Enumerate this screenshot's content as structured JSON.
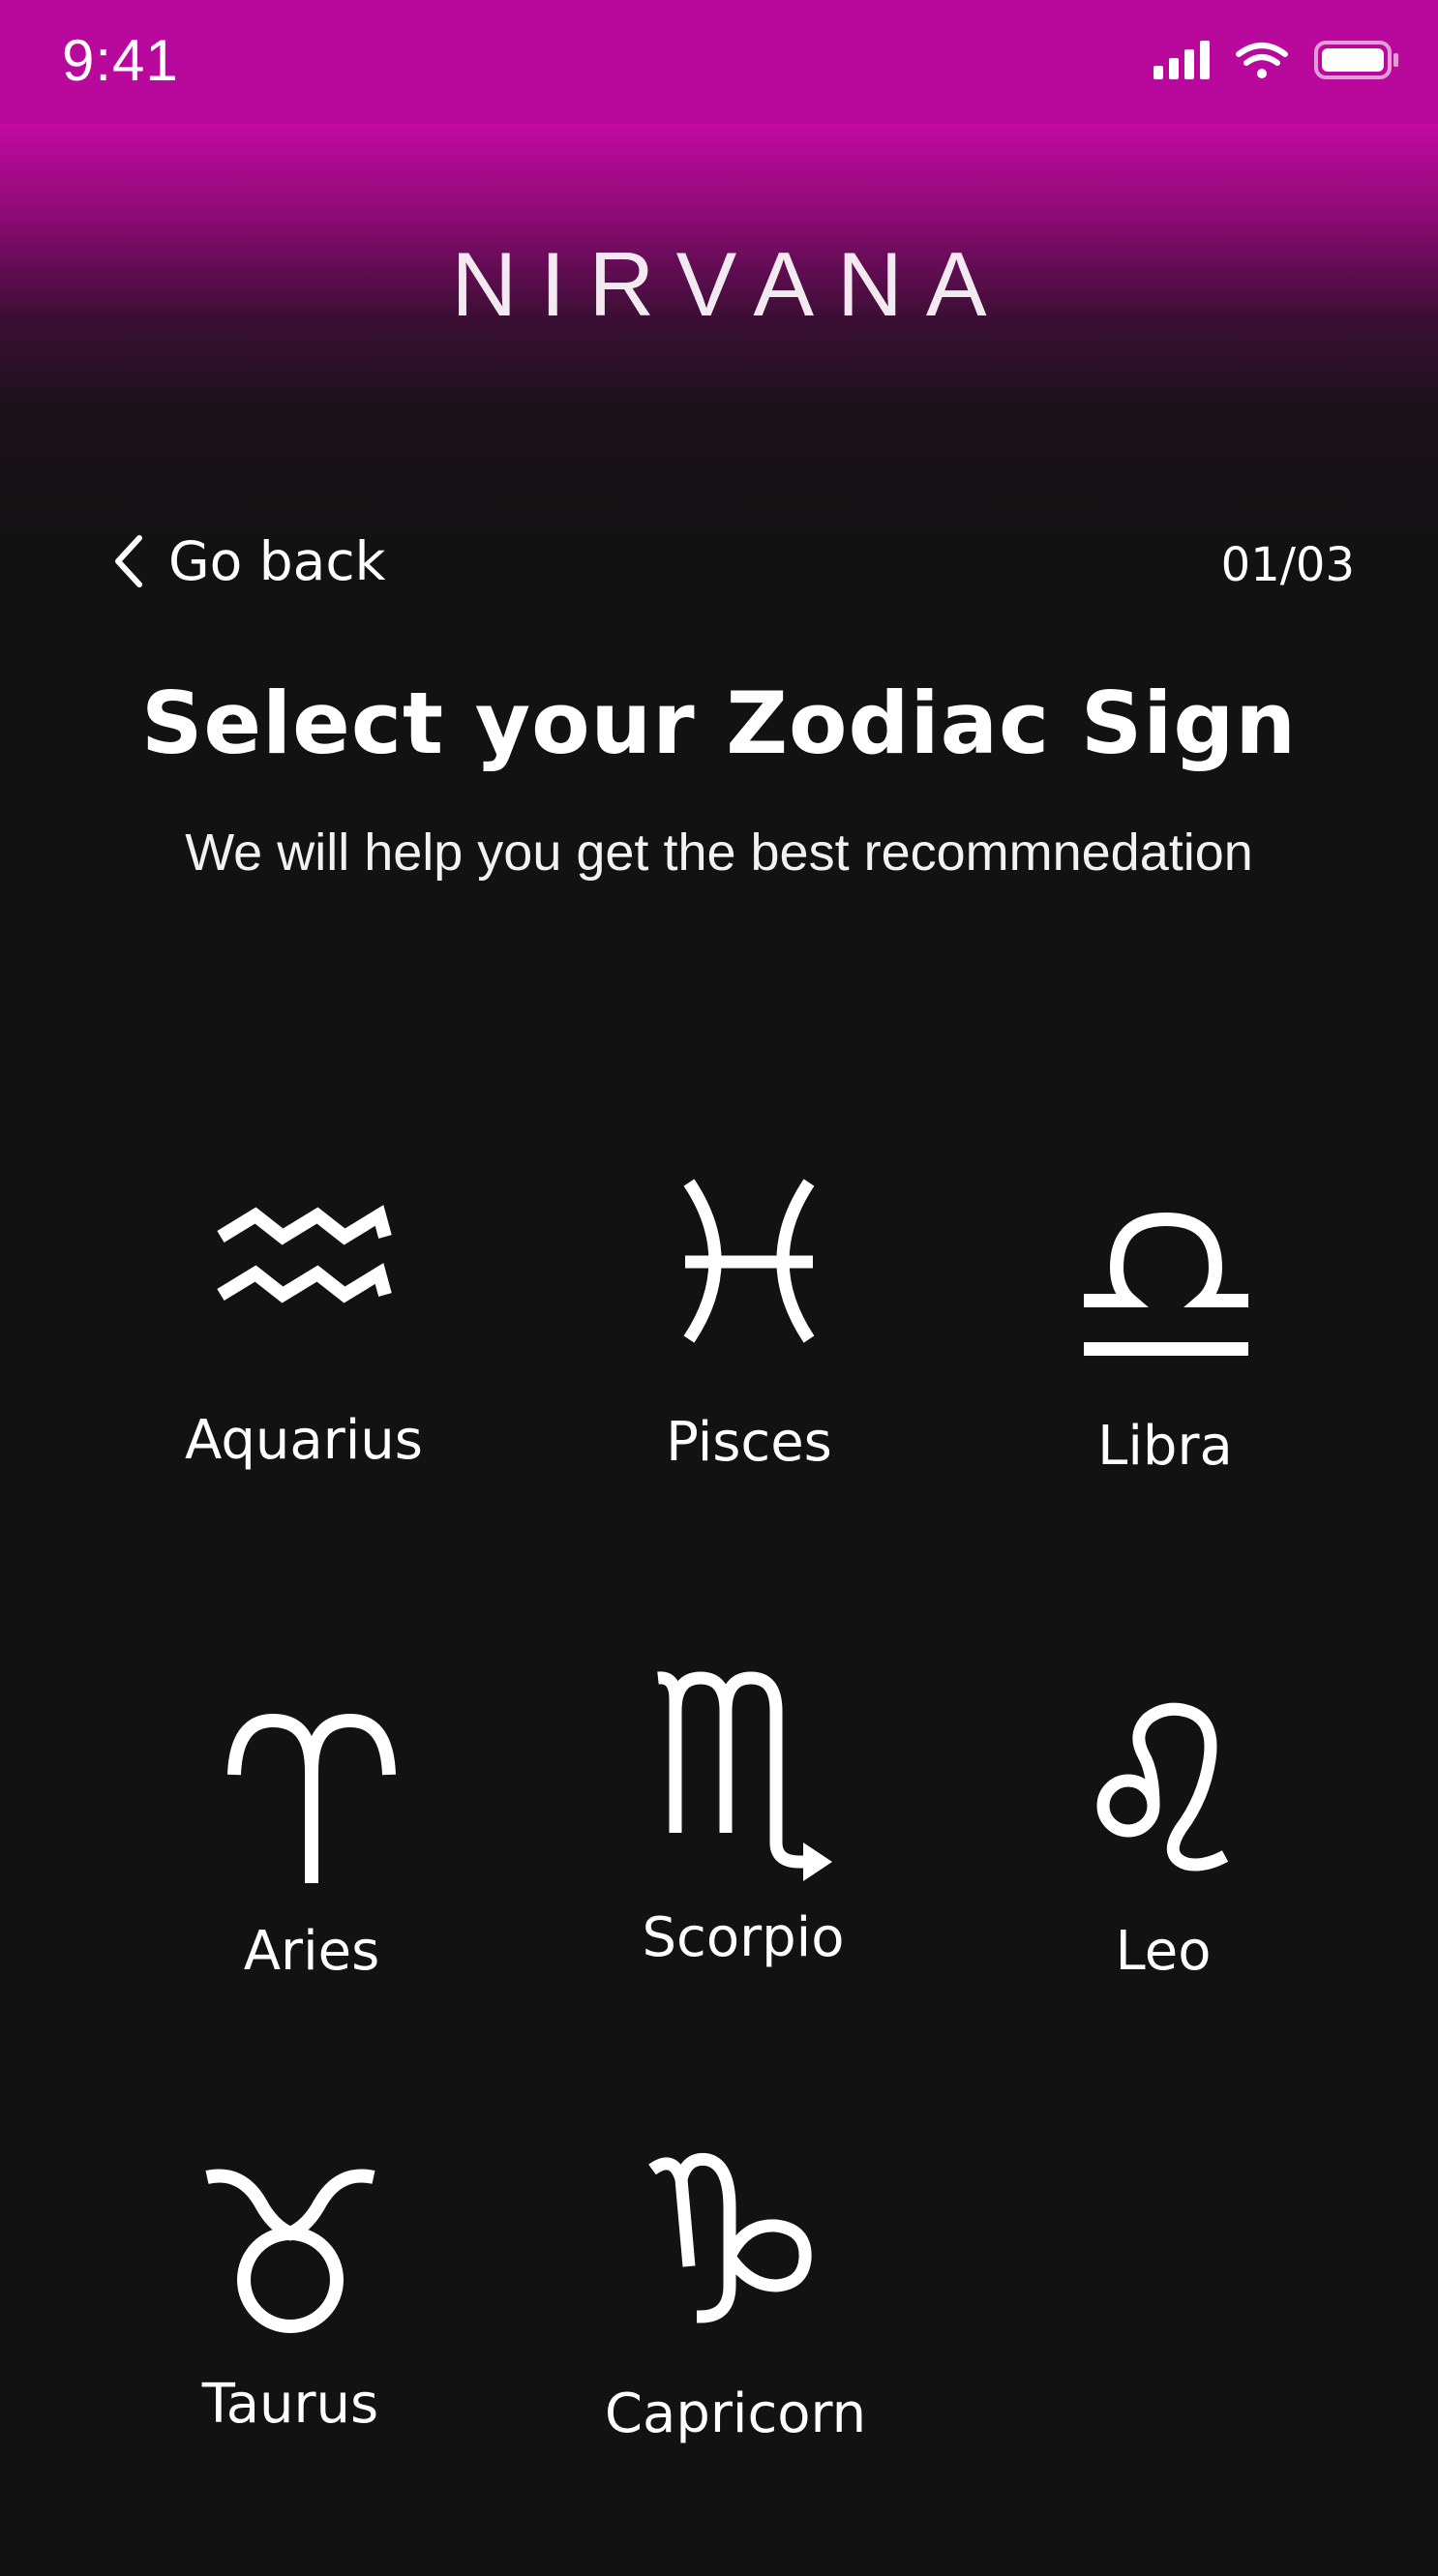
{
  "status_bar": {
    "time": "9:41",
    "icons": [
      "signal-icon",
      "wifi-icon",
      "battery-icon"
    ]
  },
  "header": {
    "brand": "NIRVANA"
  },
  "nav": {
    "back_label": "Go back",
    "step": "01/03"
  },
  "page": {
    "title": "Select your Zodiac Sign",
    "subtitle": "We will help you get the best recommnedation"
  },
  "signs": [
    {
      "label": "Aquarius",
      "icon": "aquarius-icon"
    },
    {
      "label": "Pisces",
      "icon": "pisces-icon"
    },
    {
      "label": "Libra",
      "icon": "libra-icon"
    },
    {
      "label": "Aries",
      "icon": "aries-icon"
    },
    {
      "label": "Scorpio",
      "icon": "scorpio-icon"
    },
    {
      "label": "Leo",
      "icon": "leo-icon"
    },
    {
      "label": "Taurus",
      "icon": "taurus-icon"
    },
    {
      "label": "Capricorn",
      "icon": "capricorn-icon"
    }
  ],
  "colors": {
    "background": "#121212",
    "accent_magenta": "#b9099c",
    "text": "#ffffff"
  }
}
